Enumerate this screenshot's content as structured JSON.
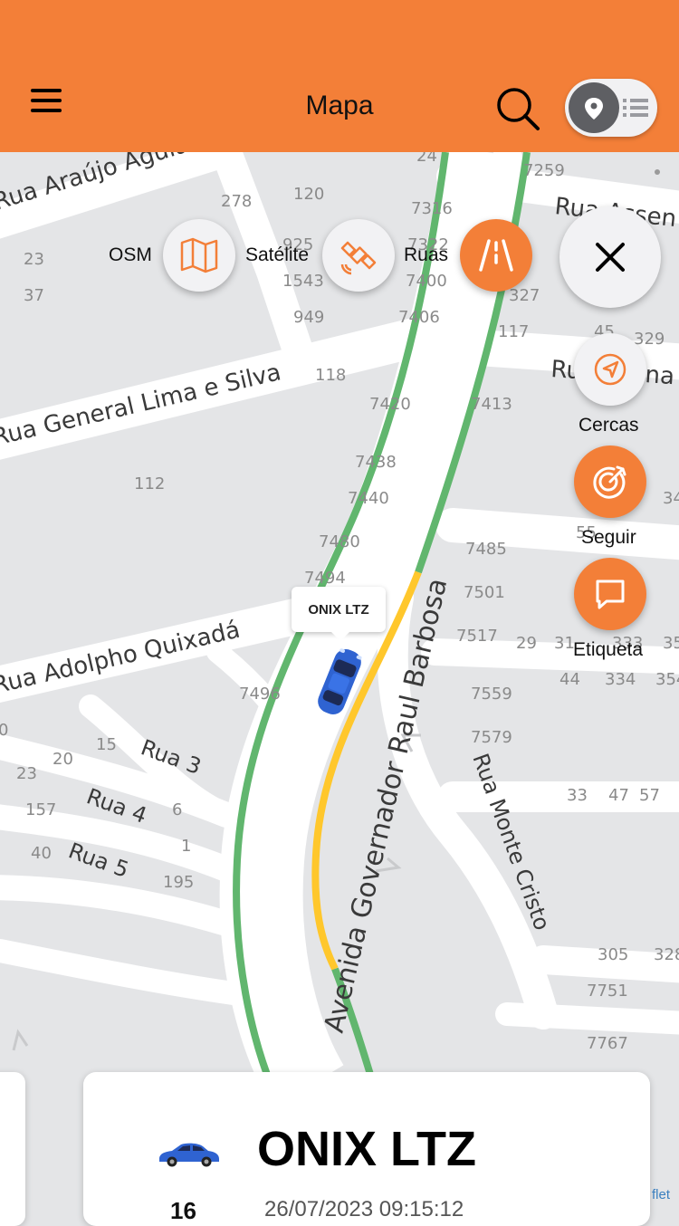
{
  "header": {
    "title": "Mapa"
  },
  "map_layers": [
    {
      "label": "OSM",
      "icon": "map-icon"
    },
    {
      "label": "Satélite",
      "icon": "satellite-icon"
    },
    {
      "label": "Ruas",
      "icon": "road-icon"
    }
  ],
  "actions": [
    {
      "label": "Cercas",
      "icon": "navigation-arrow-icon"
    },
    {
      "label": "Seguir",
      "icon": "target-icon"
    },
    {
      "label": "Etiqueta",
      "icon": "chat-bubble-icon"
    }
  ],
  "map": {
    "streets": [
      "Rua Araújo Aguiar",
      "Rua Assen",
      "Rua General Lima e Silva",
      "Rua Adolpho Quixadá",
      "Avenida Governador Raul Barbosa",
      "Rua Monte Cristo",
      "Rua 3",
      "Rua 4",
      "Rua 5",
      "Ru",
      "na"
    ],
    "numbers": [
      "7259",
      "278",
      "120",
      "7316",
      "24",
      "23",
      "37",
      "925",
      "1543",
      "7322",
      "7400",
      "327",
      "949",
      "7406",
      "45",
      "329",
      "117",
      "118",
      "7420",
      "7413",
      "7438",
      "112",
      "7440",
      "34",
      "55",
      "7485",
      "7480",
      "7494",
      "7501",
      "7517",
      "29",
      "31",
      "333",
      "35",
      "44",
      "334",
      "354",
      "7496",
      "7559",
      "7579",
      "15",
      "20",
      "0",
      "23",
      "157",
      "6",
      "40",
      "1",
      "195",
      "33",
      "47",
      "57",
      "305",
      "328",
      "7751",
      "7767"
    ],
    "attribution": "flet",
    "colors": {
      "route_green": "#61b66e",
      "route_yellow": "#ffc72c"
    }
  },
  "vehicle": {
    "marker_label": "ONIX LTZ",
    "card_name": "ONIX LTZ",
    "speed": "16",
    "datetime": "26/07/2023 09:15:12",
    "color": "#2f63d1"
  },
  "colors": {
    "accent": "#f37f38"
  }
}
